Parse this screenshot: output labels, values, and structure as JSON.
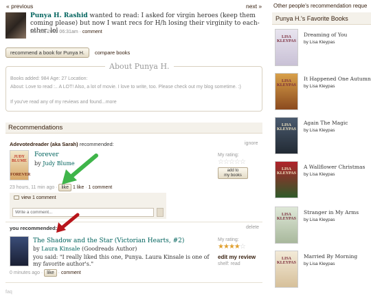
{
  "pager": {
    "prev": "« previous",
    "next": "next »"
  },
  "update": {
    "user": "Punya H. Rashid",
    "verb": " wanted to read: I asked for virgin heroes (keep them coming please) but now I want recs for H/h losing their virginity to each-other. lol",
    "time": "Jan 23, 2012 06:31am",
    "comment_link": "comment"
  },
  "actions": {
    "recommend": "recommend a book for Punya H.",
    "compare": "compare books"
  },
  "about": {
    "title": "About Punya H.",
    "stats": "Books added: 984  Age: 27  Location:",
    "bio": "About: Love to read :.. A LOT! Also, a lot of movie. I love to write, too. Please check out my blog sometime. :)",
    "more": "If you've read any of my reviews and found...more"
  },
  "recommendations_header": "Recommendations",
  "rec1": {
    "from_user": "Adevotedreader (aka Sarah)",
    "from_suffix": " recommended:",
    "ignore": "ignore",
    "title": "Forever",
    "by_prefix": "by",
    "author": "Judy Blume",
    "cover_author": "JUDY BLUME",
    "cover_title": "FOREVER",
    "my_rating": "My rating:",
    "add_btn_line1": "add to",
    "add_btn_line2": "my books",
    "time": "23 hours, 11 min ago",
    "like": "like",
    "like_count": "1 like",
    "comment_count": "1 comment",
    "view_comment": "view 1 comment",
    "comment_placeholder": "Write a comment..."
  },
  "rec2": {
    "header": "you recommended:",
    "delete": "delete",
    "title": "The Shadow and the Star (Victorian Hearts, #2)",
    "by_prefix": "by",
    "author": "Laura Kinsale",
    "author_note": "(Goodreads Author)",
    "said": "you said: \"I really liked this one, Punya. Laura Kinsale is one of my favorite author's.\"",
    "my_rating": "My rating:",
    "stars": 4,
    "edit_review": "edit my review",
    "shelf": "shelf: read",
    "time": "0 minutes ago",
    "like": "like",
    "comment": "comment"
  },
  "footer_tag": "faq",
  "sidebar": {
    "requests": "Other people's recommendation reque",
    "fav_title": "Punya H.'s Favorite Books",
    "books": [
      {
        "title": "Dreaming of You",
        "by": "by Lisa Kleypas",
        "cover_text": "LISA KLEYPAS",
        "color_top": "#e8e4ef",
        "color_bot": "#c9c1d6"
      },
      {
        "title": "It Happened One Autumn",
        "by": "by Lisa Kleypas",
        "cover_text": "LISA KLEYPAS",
        "color_top": "#d8a04a",
        "color_bot": "#8b4a1e"
      },
      {
        "title": "Again The Magic",
        "by": "by Lisa Kleypas",
        "cover_text": "LISA KLEYPAS",
        "color_top": "#4a5a6e",
        "color_bot": "#222a34"
      },
      {
        "title": "A Wallflower Christmas",
        "by": "by Lisa Kleypas",
        "cover_text": "LISA KLEYPAS",
        "color_top": "#b0222a",
        "color_bot": "#2f5b2a"
      },
      {
        "title": "Stranger in My Arms",
        "by": "by Lisa Kleypas",
        "cover_text": "LISA KLEYPAS",
        "color_top": "#dfe8d8",
        "color_bot": "#a8b89c"
      },
      {
        "title": "Married By Morning",
        "by": "by Lisa Kleypas",
        "cover_text": "LISA KLEYPAS",
        "color_top": "#f3ead8",
        "color_bot": "#d6c09a"
      }
    ]
  }
}
